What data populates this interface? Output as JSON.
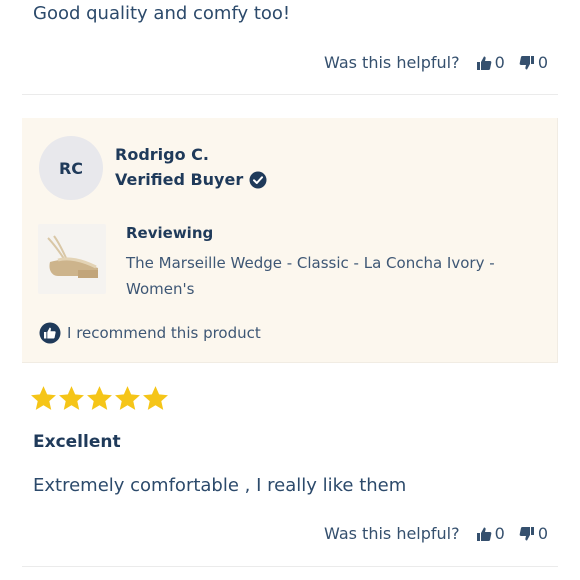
{
  "previous_review": {
    "body": "Good quality and comfy too!",
    "helpful": {
      "question": "Was this helpful?",
      "up_count": "0",
      "down_count": "0"
    }
  },
  "reviewer": {
    "initials": "RC",
    "name": "Rodrigo C.",
    "badge": "Verified Buyer",
    "reviewing_label": "Reviewing",
    "product_name": "The Marseille Wedge - Classic - La Concha Ivory - Women's",
    "recommend_text": "I recommend this product"
  },
  "review": {
    "rating": 5,
    "title": "Excellent",
    "body": "Extremely comfortable , I really like them",
    "helpful": {
      "question": "Was this helpful?",
      "up_count": "0",
      "down_count": "0"
    }
  },
  "colors": {
    "navy": "#1f3a5a",
    "star": "#f5c518",
    "card_bg": "#fcf7ee"
  }
}
